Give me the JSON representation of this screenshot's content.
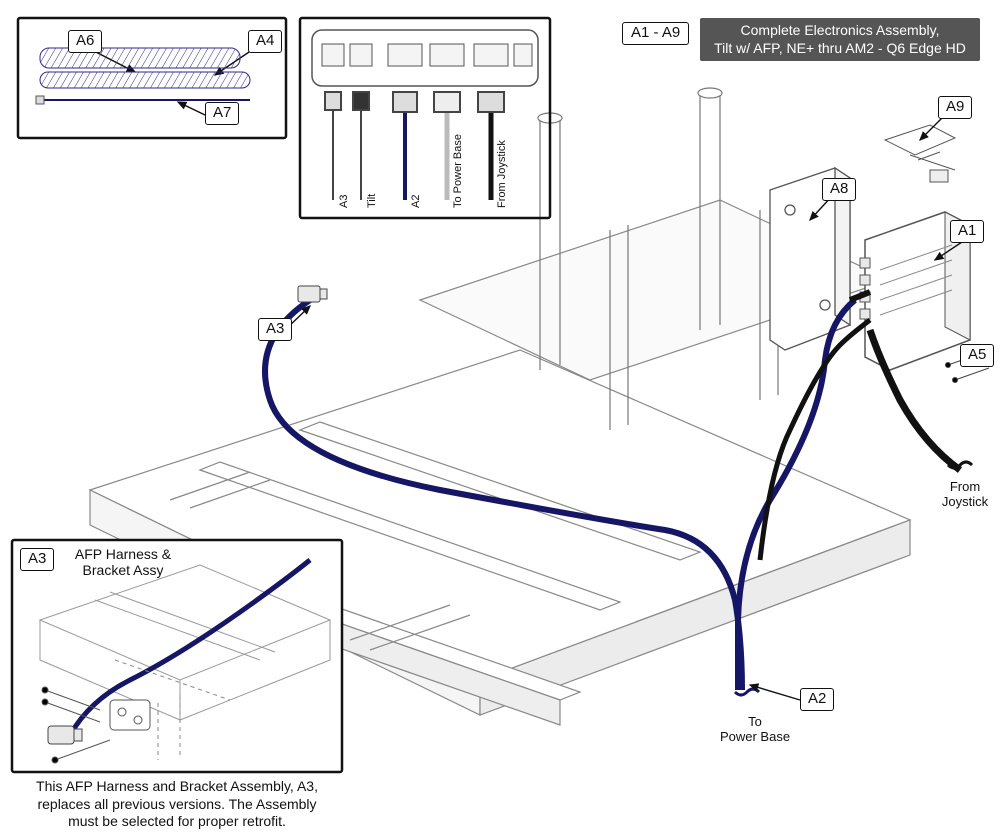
{
  "header": {
    "range": "A1 - A9",
    "title_line1": "Complete Electronics Assembly,",
    "title_line2": "Tilt w/ AFP, NE+ thru AM2 - Q6 Edge HD"
  },
  "callouts": {
    "A1": "A1",
    "A2": "A2",
    "A3_main": "A3",
    "A3_inset": "A3",
    "A4": "A4",
    "A5": "A5",
    "A6": "A6",
    "A7": "A7",
    "A8": "A8",
    "A9": "A9"
  },
  "connector_panel": {
    "c1": "A3",
    "c2": "Tilt",
    "c3": "A2",
    "c4": "To Power Base",
    "c5": "From Joystick"
  },
  "wire_labels": {
    "to_power_base": "To\nPower Base",
    "from_joystick": "From\nJoystick"
  },
  "afp_inset": {
    "label1": "AFP Harness &",
    "label2": "Bracket Assy"
  },
  "footnote": {
    "line1": "This AFP Harness and Bracket Assembly, A3,",
    "line2": "replaces all previous versions. The Assembly",
    "line3": "must be selected for proper retrofit."
  }
}
